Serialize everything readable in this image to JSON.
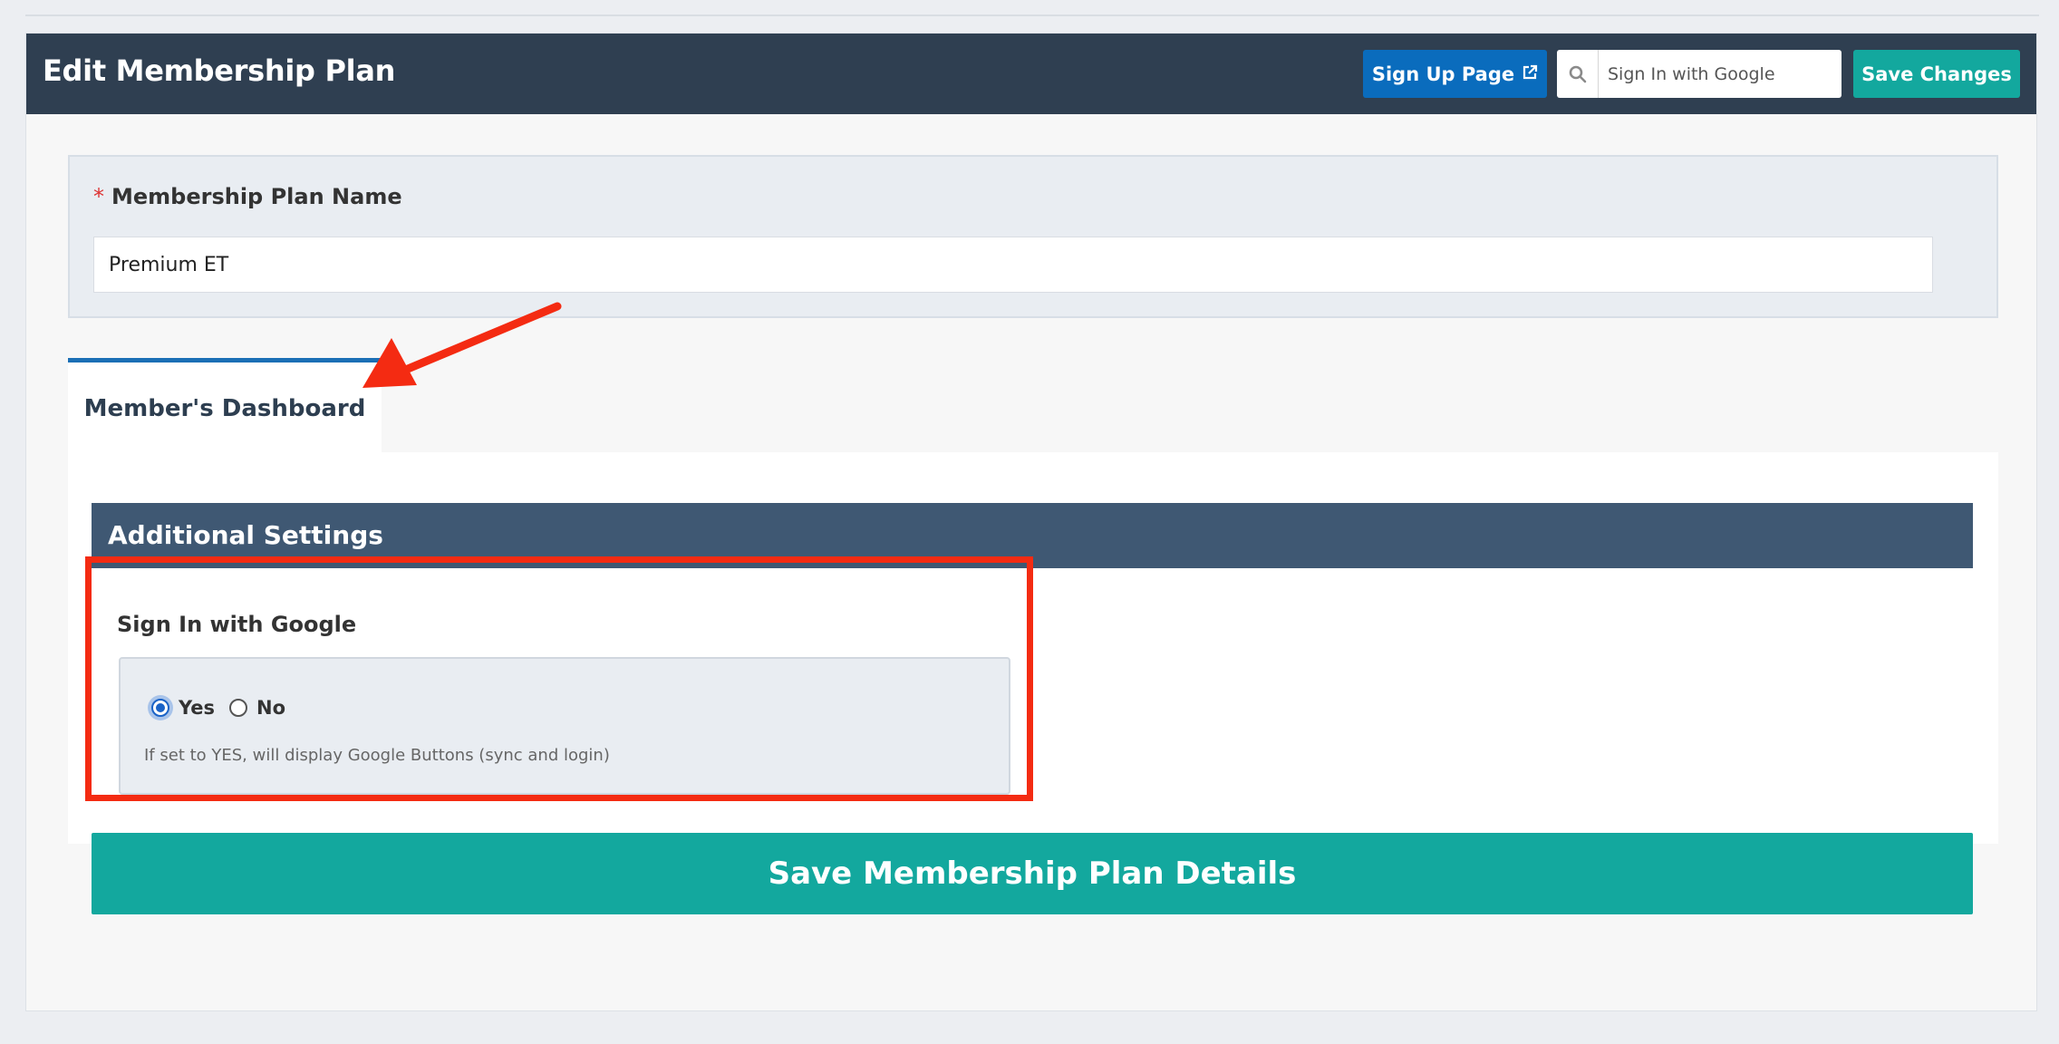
{
  "header": {
    "title": "Edit Membership Plan",
    "signup_button": "Sign Up Page",
    "search": {
      "value": "Sign In with Google",
      "placeholder": ""
    },
    "save_changes_button": "Save Changes"
  },
  "form": {
    "plan_name": {
      "required_marker": "*",
      "label": "Membership Plan Name",
      "value": "Premium ET"
    }
  },
  "tabs": [
    {
      "label": "Member's Dashboard",
      "active": true
    }
  ],
  "additional_settings": {
    "section_title": "Additional Settings",
    "sign_in_with_google": {
      "label": "Sign In with Google",
      "options": [
        {
          "label": "Yes",
          "selected": true
        },
        {
          "label": "No",
          "selected": false
        }
      ],
      "help_text": "If set to YES, will display Google Buttons (sync and login)"
    }
  },
  "footer": {
    "save_button": "Save Membership Plan Details"
  },
  "colors": {
    "header_bg": "#2f3f51",
    "primary_blue": "#0a6cbd",
    "teal": "#13a89e",
    "section_bar": "#3f5873",
    "annotation_red": "#f42b12"
  },
  "icons": {
    "external_link": "external-link-icon",
    "search": "search-icon",
    "annotation_arrow": "arrow-icon"
  }
}
